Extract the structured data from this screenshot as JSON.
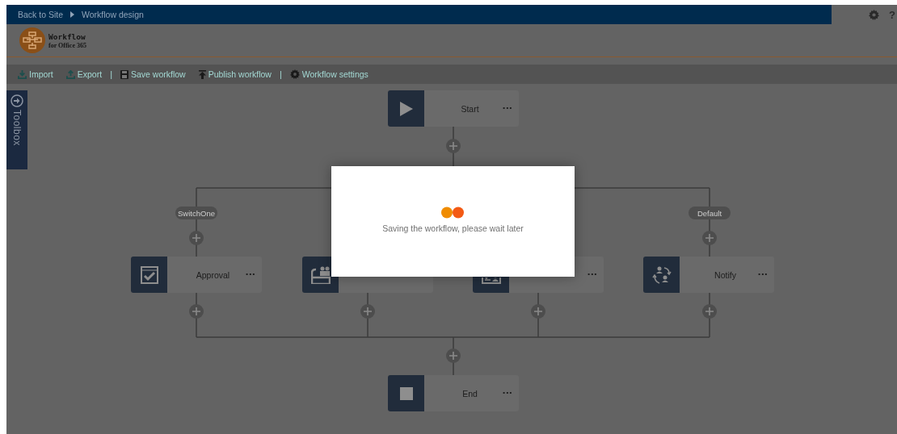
{
  "top_bar": {
    "breadcrumb": [
      {
        "label": "Back to Site"
      },
      {
        "label": "Workflow design"
      }
    ],
    "help": "?"
  },
  "header": {
    "logo_title": "Workflow",
    "logo_subtitle": "for Office 365"
  },
  "toolbar": [
    {
      "kind": "import",
      "label": "Import"
    },
    {
      "kind": "export",
      "label": "Export"
    },
    {
      "kind": "separator",
      "label": "|"
    },
    {
      "kind": "save",
      "label": "Save workflow"
    },
    {
      "kind": "publish",
      "label": "Publish workflow"
    },
    {
      "kind": "separator",
      "label": "|"
    },
    {
      "kind": "settings",
      "label": "Workflow settings"
    }
  ],
  "toolbox": {
    "label": "Toolbox"
  },
  "diagram": {
    "nodes": [
      {
        "kind": "start",
        "label": "Start",
        "menu": "···"
      },
      {
        "kind": "approval",
        "label": "Approval",
        "menu": "···"
      },
      {
        "kind": "countersign"
      },
      {
        "kind": "assign",
        "menu": "···"
      },
      {
        "kind": "notify",
        "label": "Notify",
        "menu": "···"
      },
      {
        "kind": "end",
        "label": "End",
        "menu": "···"
      }
    ],
    "branches": [
      {
        "label": "SwitchOne"
      },
      {
        "label": "Default"
      }
    ]
  },
  "modal": {
    "message": "Saving the workflow, please wait later"
  }
}
